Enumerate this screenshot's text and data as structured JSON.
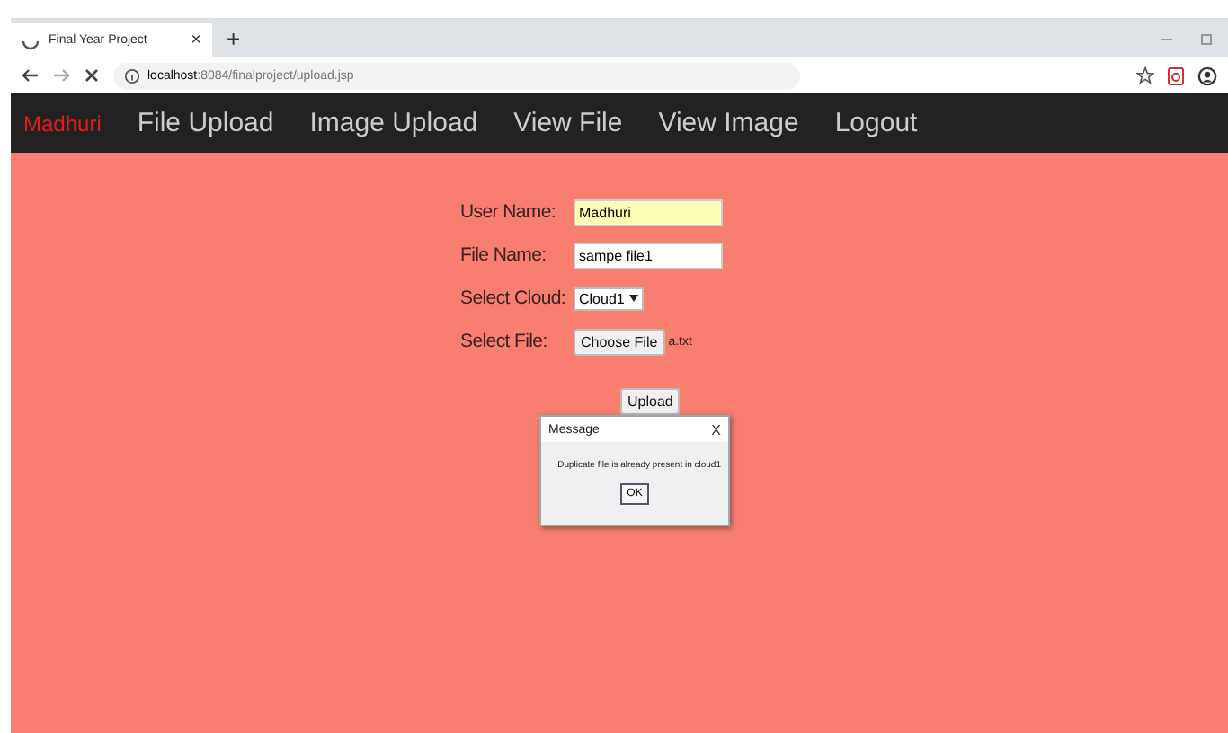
{
  "browser": {
    "tab_title": "Final Year Project",
    "tab_close": "×",
    "new_tab": "+",
    "url_host": "localhost",
    "url_path": ":8084/finalproject/upload.jsp"
  },
  "nav": {
    "brand": "Madhuri",
    "items": [
      "File Upload",
      "Image Upload",
      "View File",
      "View Image",
      "Logout"
    ]
  },
  "form": {
    "fields": [
      {
        "kind": "text",
        "label": "User Name:",
        "value": "Madhuri",
        "autofilled": true
      },
      {
        "kind": "text",
        "label": "File Name:",
        "value": "sampe file1",
        "autofilled": false
      },
      {
        "kind": "select",
        "label": "Select Cloud:",
        "value": "Cloud1"
      },
      {
        "kind": "file",
        "label": "Select File:",
        "button": "Choose File",
        "value": "a.txt"
      }
    ],
    "submit": "Upload"
  },
  "dialog": {
    "title": "Message",
    "close": "X",
    "message": "Duplicate file is already present in cloud1",
    "ok": "OK"
  }
}
